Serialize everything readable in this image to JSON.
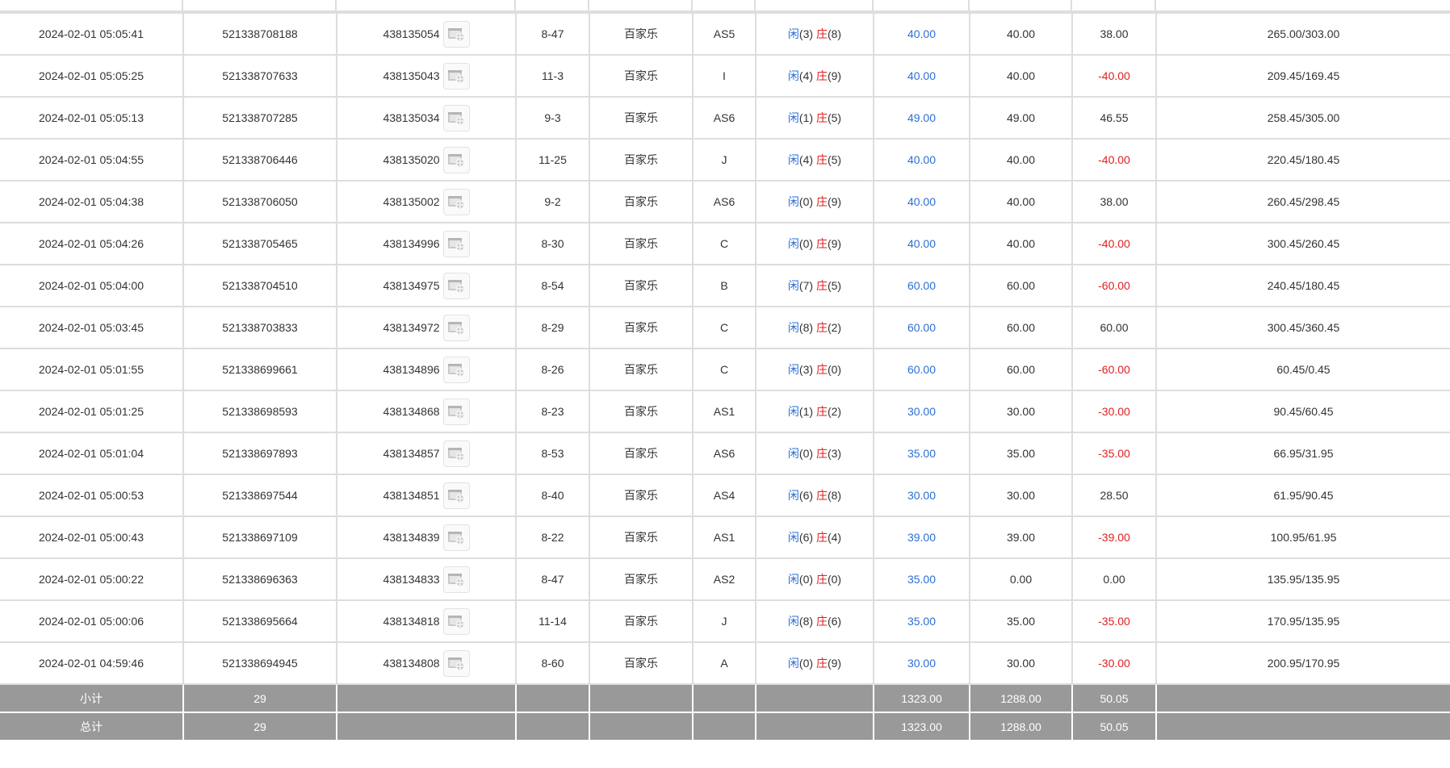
{
  "columns_meta": {
    "player_label": "闲",
    "banker_label": "庄"
  },
  "rows": [
    {
      "time": "2024-02-01 05:05:41",
      "bet_id": "521338708188",
      "ticket": "438135054",
      "round": "8-47",
      "game": "百家乐",
      "table": "AS5",
      "player": "(3)",
      "banker": "(8)",
      "bet": "40.00",
      "valid": "40.00",
      "winloss": "38.00",
      "winloss_color": "normal",
      "balance": "265.00/303.00"
    },
    {
      "time": "2024-02-01 05:05:25",
      "bet_id": "521338707633",
      "ticket": "438135043",
      "round": "11-3",
      "game": "百家乐",
      "table": "I",
      "player": "(4)",
      "banker": "(9)",
      "bet": "40.00",
      "valid": "40.00",
      "winloss": "-40.00",
      "winloss_color": "red",
      "balance": "209.45/169.45"
    },
    {
      "time": "2024-02-01 05:05:13",
      "bet_id": "521338707285",
      "ticket": "438135034",
      "round": "9-3",
      "game": "百家乐",
      "table": "AS6",
      "player": "(1)",
      "banker": "(5)",
      "bet": "49.00",
      "valid": "49.00",
      "winloss": "46.55",
      "winloss_color": "normal",
      "balance": "258.45/305.00"
    },
    {
      "time": "2024-02-01 05:04:55",
      "bet_id": "521338706446",
      "ticket": "438135020",
      "round": "11-25",
      "game": "百家乐",
      "table": "J",
      "player": "(4)",
      "banker": "(5)",
      "bet": "40.00",
      "valid": "40.00",
      "winloss": "-40.00",
      "winloss_color": "red",
      "balance": "220.45/180.45"
    },
    {
      "time": "2024-02-01 05:04:38",
      "bet_id": "521338706050",
      "ticket": "438135002",
      "round": "9-2",
      "game": "百家乐",
      "table": "AS6",
      "player": "(0)",
      "banker": "(9)",
      "bet": "40.00",
      "valid": "40.00",
      "winloss": "38.00",
      "winloss_color": "normal",
      "balance": "260.45/298.45"
    },
    {
      "time": "2024-02-01 05:04:26",
      "bet_id": "521338705465",
      "ticket": "438134996",
      "round": "8-30",
      "game": "百家乐",
      "table": "C",
      "player": "(0)",
      "banker": "(9)",
      "bet": "40.00",
      "valid": "40.00",
      "winloss": "-40.00",
      "winloss_color": "red",
      "balance": "300.45/260.45"
    },
    {
      "time": "2024-02-01 05:04:00",
      "bet_id": "521338704510",
      "ticket": "438134975",
      "round": "8-54",
      "game": "百家乐",
      "table": "B",
      "player": "(7)",
      "banker": "(5)",
      "bet": "60.00",
      "valid": "60.00",
      "winloss": "-60.00",
      "winloss_color": "red",
      "balance": "240.45/180.45"
    },
    {
      "time": "2024-02-01 05:03:45",
      "bet_id": "521338703833",
      "ticket": "438134972",
      "round": "8-29",
      "game": "百家乐",
      "table": "C",
      "player": "(8)",
      "banker": "(2)",
      "bet": "60.00",
      "valid": "60.00",
      "winloss": "60.00",
      "winloss_color": "normal",
      "balance": "300.45/360.45"
    },
    {
      "time": "2024-02-01 05:01:55",
      "bet_id": "521338699661",
      "ticket": "438134896",
      "round": "8-26",
      "game": "百家乐",
      "table": "C",
      "player": "(3)",
      "banker": "(0)",
      "bet": "60.00",
      "valid": "60.00",
      "winloss": "-60.00",
      "winloss_color": "red",
      "balance": "60.45/0.45"
    },
    {
      "time": "2024-02-01 05:01:25",
      "bet_id": "521338698593",
      "ticket": "438134868",
      "round": "8-23",
      "game": "百家乐",
      "table": "AS1",
      "player": "(1)",
      "banker": "(2)",
      "bet": "30.00",
      "valid": "30.00",
      "winloss": "-30.00",
      "winloss_color": "red",
      "balance": "90.45/60.45"
    },
    {
      "time": "2024-02-01 05:01:04",
      "bet_id": "521338697893",
      "ticket": "438134857",
      "round": "8-53",
      "game": "百家乐",
      "table": "AS6",
      "player": "(0)",
      "banker": "(3)",
      "bet": "35.00",
      "valid": "35.00",
      "winloss": "-35.00",
      "winloss_color": "red",
      "balance": "66.95/31.95"
    },
    {
      "time": "2024-02-01 05:00:53",
      "bet_id": "521338697544",
      "ticket": "438134851",
      "round": "8-40",
      "game": "百家乐",
      "table": "AS4",
      "player": "(6)",
      "banker": "(8)",
      "bet": "30.00",
      "valid": "30.00",
      "winloss": "28.50",
      "winloss_color": "normal",
      "balance": "61.95/90.45"
    },
    {
      "time": "2024-02-01 05:00:43",
      "bet_id": "521338697109",
      "ticket": "438134839",
      "round": "8-22",
      "game": "百家乐",
      "table": "AS1",
      "player": "(6)",
      "banker": "(4)",
      "bet": "39.00",
      "valid": "39.00",
      "winloss": "-39.00",
      "winloss_color": "red",
      "balance": "100.95/61.95"
    },
    {
      "time": "2024-02-01 05:00:22",
      "bet_id": "521338696363",
      "ticket": "438134833",
      "round": "8-47",
      "game": "百家乐",
      "table": "AS2",
      "player": "(0)",
      "banker": "(0)",
      "bet": "35.00",
      "valid": "0.00",
      "winloss": "0.00",
      "winloss_color": "normal",
      "balance": "135.95/135.95"
    },
    {
      "time": "2024-02-01 05:00:06",
      "bet_id": "521338695664",
      "ticket": "438134818",
      "round": "11-14",
      "game": "百家乐",
      "table": "J",
      "player": "(8)",
      "banker": "(6)",
      "bet": "35.00",
      "valid": "35.00",
      "winloss": "-35.00",
      "winloss_color": "red",
      "balance": "170.95/135.95"
    },
    {
      "time": "2024-02-01 04:59:46",
      "bet_id": "521338694945",
      "ticket": "438134808",
      "round": "8-60",
      "game": "百家乐",
      "table": "A",
      "player": "(0)",
      "banker": "(9)",
      "bet": "30.00",
      "valid": "30.00",
      "winloss": "-30.00",
      "winloss_color": "red",
      "balance": "200.95/170.95"
    }
  ],
  "subtotal": {
    "label": "小计",
    "count": "29",
    "bet": "1323.00",
    "valid": "1288.00",
    "winloss": "50.05"
  },
  "grand_total": {
    "label": "总计",
    "count": "29",
    "bet": "1323.00",
    "valid": "1288.00",
    "winloss": "50.05"
  },
  "colors": {
    "blue": "#2b6fd6",
    "red": "#e02020",
    "summary_bg": "#999999",
    "border": "#dddddd"
  },
  "icons": {
    "replay": "video-record-icon"
  }
}
